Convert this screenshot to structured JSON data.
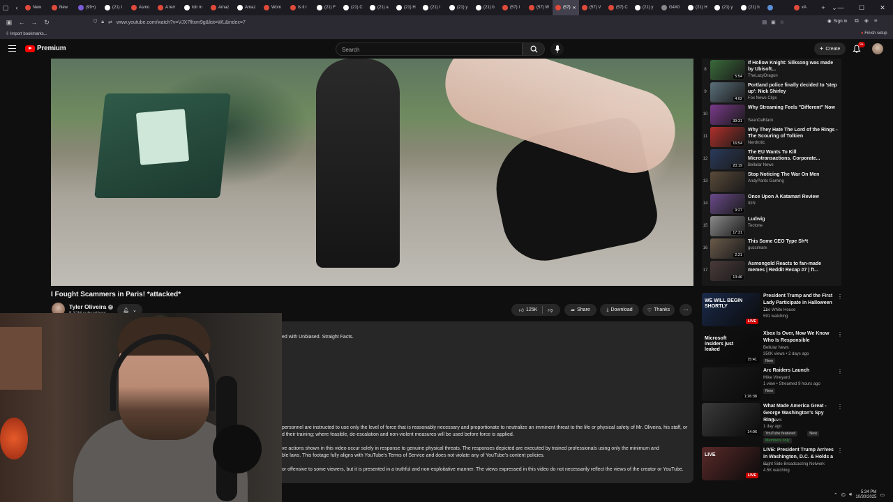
{
  "browser": {
    "tabs": [
      {
        "label": "New",
        "color": "#e04a3a"
      },
      {
        "label": "New",
        "color": "#e04a3a"
      },
      {
        "label": "(99+)",
        "color": "#7b5cd6"
      },
      {
        "label": "(21) I",
        "color": "#ffffff"
      },
      {
        "label": "Asmo",
        "color": "#e04a3a"
      },
      {
        "label": "A terr",
        "color": "#e04a3a"
      },
      {
        "label": "lotr m",
        "color": "#ffffff"
      },
      {
        "label": "Amaz",
        "color": "#e04a3a"
      },
      {
        "label": "Amaz",
        "color": "#ffffff"
      },
      {
        "label": "Wom",
        "color": "#e04a3a"
      },
      {
        "label": "Is it r",
        "color": "#e04a3a"
      },
      {
        "label": "(21) F",
        "color": "#ffffff"
      },
      {
        "label": "(21) C",
        "color": "#ffffff"
      },
      {
        "label": "(21) a",
        "color": "#ffffff"
      },
      {
        "label": "(21) H",
        "color": "#ffffff"
      },
      {
        "label": "(21) I",
        "color": "#ffffff"
      },
      {
        "label": "(21) y",
        "color": "#ffffff"
      },
      {
        "label": "(21) b",
        "color": "#ffffff"
      },
      {
        "label": "(57) I",
        "color": "#e04a3a"
      },
      {
        "label": "(57) W",
        "color": "#e04a3a"
      },
      {
        "label": "(57)",
        "color": "#e04a3a",
        "active": true
      },
      {
        "label": "(57) V",
        "color": "#e04a3a"
      },
      {
        "label": "(57) C",
        "color": "#e04a3a"
      },
      {
        "label": "(21) y",
        "color": "#ffffff"
      },
      {
        "label": "G4X0",
        "color": "#888888"
      },
      {
        "label": "(21) H",
        "color": "#ffffff"
      },
      {
        "label": "(21) y",
        "color": "#ffffff"
      },
      {
        "label": "(21) h",
        "color": "#ffffff"
      },
      {
        "label": "",
        "color": "#5b8fd6"
      },
      {
        "label": "xA",
        "color": "#e04a3a"
      }
    ],
    "url": "www.youtube.com/watch?v=VJX7fltxm9g&list=WL&index=7",
    "sign_in": "Sign in",
    "bookmarks_label": "Import bookmarks...",
    "finish_setup": "Finish setup"
  },
  "header": {
    "brand": "Premium",
    "search_placeholder": "Search",
    "create_label": "Create",
    "notif_count": "9+"
  },
  "video": {
    "title": "I Fought Scammers in Paris! *attacked*",
    "channel": "Tyler Oliveira",
    "subscribers": "5.32M subscribers",
    "likes": "125K",
    "share": "Share",
    "download": "Download",
    "thanks": "Thanks"
  },
  "description": {
    "lines": [
      "ed with Unbiased. Straight Facts.",
      "personnel are instructed to use only the level of force that is reasonably necessary and proportionate to neutralize an imminent threat to the life or physical safety of Mr. Oliveira, his staff, or",
      "d their training; where feasible, de-escalation and non-violent measures will be used before force is applied.",
      "ve actions shown in this video occur solely in response to genuine physical threats. The responses depicted are executed by trained professionals using only the minimum and",
      "ble laws. This footage fully aligns with YouTube's Terms of Service and does not violate any of YouTube's content policies.",
      "or offensive to some viewers, but it is presented in a truthful and non-exploitative manner. The views expressed in this video do not necessarily reflect the views of the creator or YouTube."
    ]
  },
  "playlist": [
    {
      "index": "8",
      "title": "If Hollow Knight: Silksong was made by Ubisoft...",
      "channel": "TheLazyDragon",
      "duration": "5:54",
      "color": "#3a6a3a"
    },
    {
      "index": "9",
      "title": "Portland police finally decided to 'step up': Nick Shirley",
      "channel": "Fox News Clips",
      "duration": "4:02",
      "color": "#5a6f7a"
    },
    {
      "index": "10",
      "title": "Why Streaming Feels \"Different\" Now",
      "channel": "SeanDaBlack",
      "duration": "39:31",
      "color": "#7a3a8a"
    },
    {
      "index": "11",
      "title": "Why They Hate The Lord of the Rings - The Scouring of Tolkien",
      "channel": "Nerdrotic",
      "duration": "16:54",
      "color": "#b0302a"
    },
    {
      "index": "12",
      "title": "The EU Wants To Kill Microtransactions. Corporate...",
      "channel": "Bellular News",
      "duration": "20:19",
      "color": "#2a3a5a"
    },
    {
      "index": "13",
      "title": "Stop Noticing The War On Men",
      "channel": "AndyPants Gaming",
      "duration": "",
      "color": "#5a4a3a"
    },
    {
      "index": "14",
      "title": "Once Upon A Katamari Review",
      "channel": "IGN",
      "duration": "9:27",
      "color": "#6a4a8a"
    },
    {
      "index": "15",
      "title": "Ludwig",
      "channel": "Tectone",
      "duration": "17:31",
      "color": "#8a8a8a"
    },
    {
      "index": "16",
      "title": "This Some CEO Type Sh*t",
      "channel": "guccimarx",
      "duration": "2:21",
      "color": "#6a5a4a"
    },
    {
      "index": "17",
      "title": "Asmongold Reacts to fan-made memes | Reddit Recap #7 | ft...",
      "channel": "",
      "duration": "13:46",
      "color": "#4a3a3a"
    }
  ],
  "recommendations": [
    {
      "title": "President Trump and the First Lady Participate in Halloween ...",
      "meta1": "The White House",
      "meta2": "591 watching",
      "badge": "LIVE",
      "thumb_text": "WE WILL BEGIN SHORTLY",
      "tags": [],
      "color": "#1a2a4a"
    },
    {
      "title": "Xbox Is Over, Now We Know Who Is Responsible",
      "meta1": "Bellular News",
      "meta2": "350K views • 2 days ago",
      "badge": "15:41",
      "thumb_text": "Microsoft insiders just leaked",
      "tags": [
        "New"
      ],
      "color": "#111111"
    },
    {
      "title": "Arc Raiders Launch",
      "meta1": "Mike Vineyard",
      "meta2": "1 view • Streamed 9 hours ago",
      "badge": "1:26:38",
      "thumb_text": "",
      "tags": [
        "New"
      ],
      "color": "#1c1c1c"
    },
    {
      "title": "What Made America Great - George Washington's Spy Ring...",
      "meta1": "Fox News",
      "meta2": "1 day ago",
      "badge": "14:06",
      "thumb_text": "",
      "tags": [
        "YouTube featured",
        "New"
      ],
      "members": "Members only",
      "color": "#3a3a3a"
    },
    {
      "title": "LIVE: President Trump Arrives in Washington, D.C. & Holds a ...",
      "meta1": "Right Side Broadcasting Network",
      "meta2": "4.5K watching",
      "badge": "LIVE",
      "thumb_text": "LIVE",
      "tags": [],
      "color": "#5a2a2a"
    }
  ],
  "tray": {
    "time": "5:34 PM",
    "date": "10/30/2025"
  }
}
